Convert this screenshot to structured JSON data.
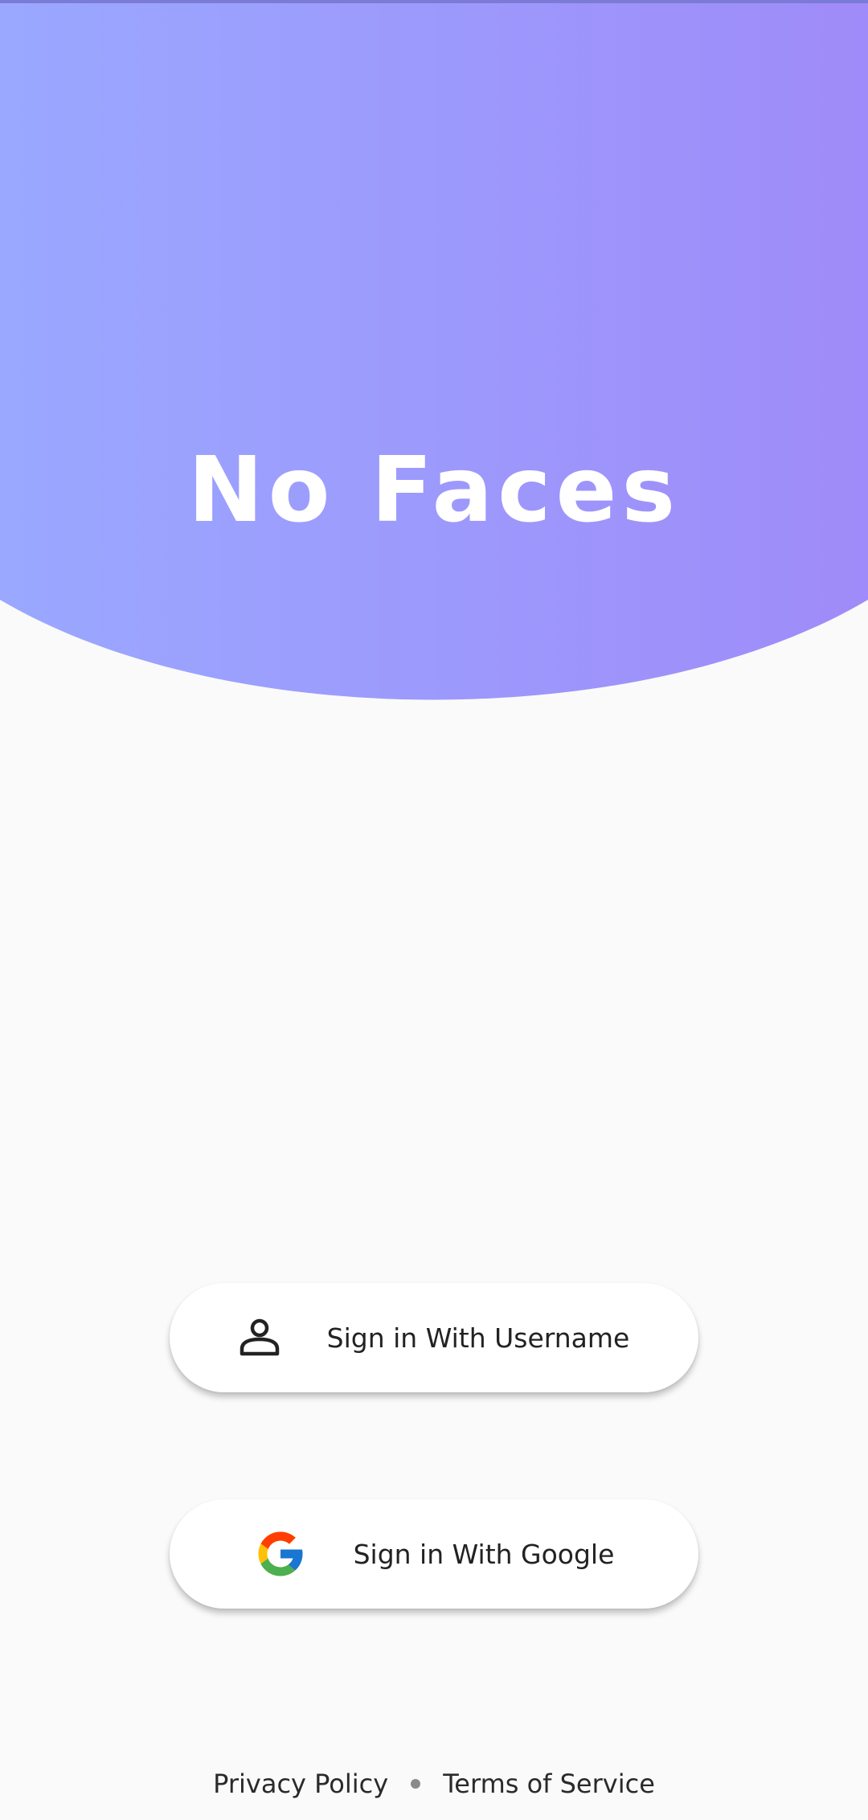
{
  "app": {
    "title": "No Faces"
  },
  "buttons": {
    "username": {
      "label": "Sign in With Username",
      "icon": "person-outline-icon"
    },
    "google": {
      "label": "Sign in With Google",
      "icon": "google-logo-icon"
    }
  },
  "footer": {
    "privacy": "Privacy Policy",
    "terms": "Terms of Service"
  },
  "colors": {
    "gradient_start": "#9aa8ff",
    "gradient_end": "#9f8bf9",
    "background": "#fafafa",
    "button_bg": "#ffffff",
    "text": "#222222"
  }
}
